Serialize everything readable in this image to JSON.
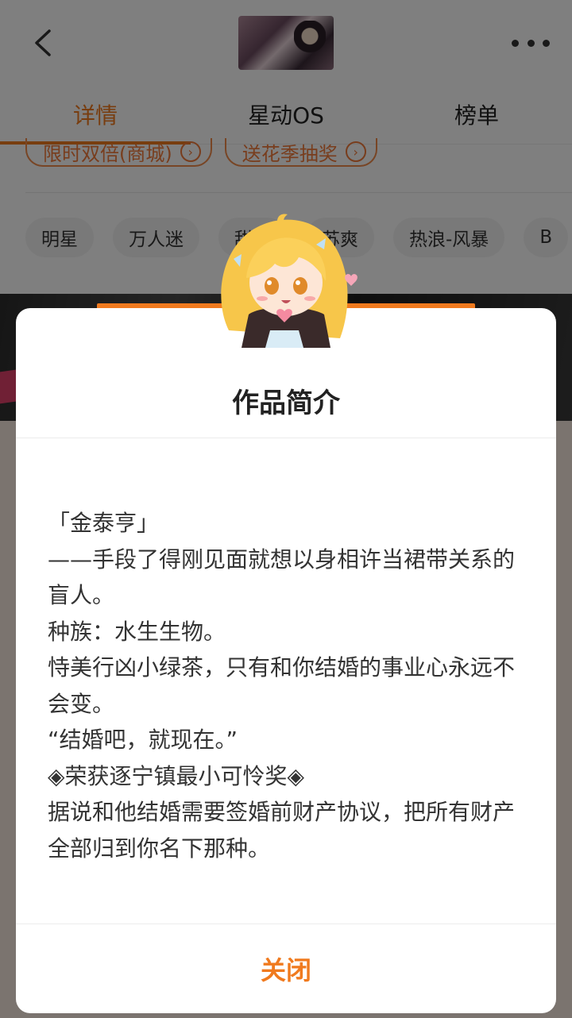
{
  "header": {
    "back_icon": "chevron-left-icon",
    "more_icon": "more-dots-icon"
  },
  "tabs": [
    {
      "label": "详情"
    },
    {
      "label": "星动OS"
    },
    {
      "label": "榜单"
    }
  ],
  "promos": [
    {
      "label": "限时双倍(商城)"
    },
    {
      "label": "送花季抽奖"
    }
  ],
  "tags": [
    "明星",
    "万人迷",
    "甜宠",
    "苏爽",
    "热浪-风暴",
    "B"
  ],
  "colors": {
    "accent": "#f07a1e",
    "overlay": "rgba(0,0,0,0.5)"
  },
  "modal": {
    "title": "作品简介",
    "body": "「金泰亨」\n——手段了得刚见面就想以身相许当裙带关系的盲人。\n种族：水生生物。\n恃美行凶小绿茶，只有和你结婚的事业心永远不会变。\n“结婚吧，就现在。”\n◈荣获逐宁镇最小可怜奖◈\n据说和他结婚需要签婚前财产协议，把所有财产全部归到你名下那种。",
    "close_label": "关闭"
  }
}
